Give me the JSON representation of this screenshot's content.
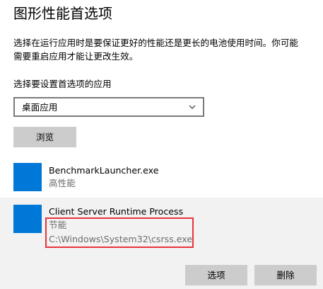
{
  "page": {
    "title": "图形性能首选项",
    "description_line1": "选择在运行应用时是要保证更好的性能还是更长的电池使用时间。你可能",
    "description_line2": "需要重启应用才能让更改生效。"
  },
  "app_selector": {
    "label": "选择要设置首选项的应用",
    "selected_value": "桌面应用",
    "browse_label": "浏览"
  },
  "apps": [
    {
      "name": "BenchmarkLauncher.exe",
      "preference": "高性能",
      "icon": "app-tile-icon"
    },
    {
      "name": "Client Server Runtime Process",
      "preference": "节能",
      "path": "C:\\Windows\\System32\\csrss.exe",
      "icon": "app-tile-icon",
      "actions": {
        "options_label": "选项",
        "delete_label": "删除"
      }
    }
  ],
  "colors": {
    "accent": "#0078d7",
    "button_bg": "#cccccc",
    "selected_item_bg": "#f2f2f2",
    "secondary_text": "#6d6d6d",
    "highlight_border": "#e8333a"
  }
}
